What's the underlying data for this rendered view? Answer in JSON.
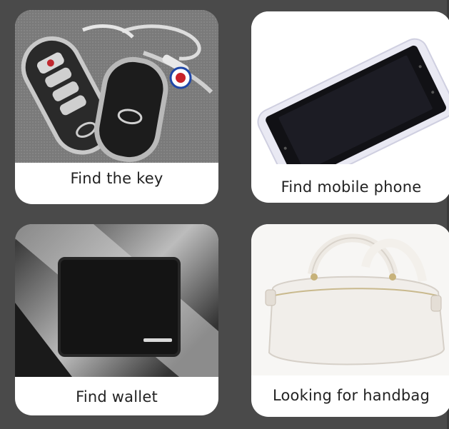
{
  "cards": [
    {
      "caption": "Find the key",
      "image": "car-key-fob"
    },
    {
      "caption": "Find mobile phone",
      "image": "smartphone"
    },
    {
      "caption": "Find wallet",
      "image": "wallet"
    },
    {
      "caption": "Looking for handbag",
      "image": "handbag"
    }
  ],
  "colors": {
    "background": "#4a4a4a",
    "card": "#ffffff",
    "text": "#222222"
  }
}
